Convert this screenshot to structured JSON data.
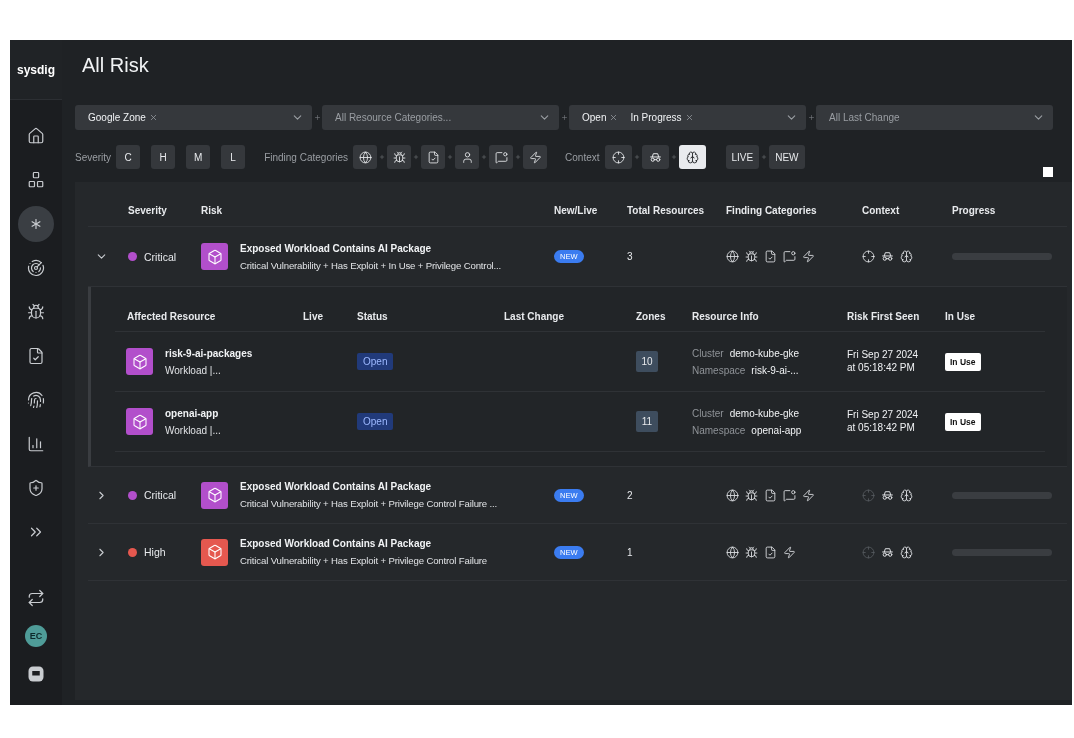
{
  "sidebar": {
    "logo": "sysdig",
    "nav": [
      {
        "kind": "home",
        "selected": false
      },
      {
        "kind": "blocks",
        "selected": false
      },
      {
        "kind": "asterisk",
        "selected": true
      },
      {
        "kind": "radar",
        "selected": false
      },
      {
        "kind": "bug",
        "selected": false
      },
      {
        "kind": "filecheck",
        "selected": false
      },
      {
        "kind": "fingerprint",
        "selected": false
      },
      {
        "kind": "chart",
        "selected": false
      },
      {
        "kind": "shield",
        "selected": false
      },
      {
        "kind": "expand",
        "selected": false
      }
    ],
    "bottom": [
      {
        "kind": "repeat"
      },
      {
        "kind": "avatar",
        "initials": "EC"
      },
      {
        "kind": "chat"
      }
    ]
  },
  "page": {
    "title": "All Risk"
  },
  "filters": [
    {
      "kind": "chips",
      "chips": [
        "Google Zone"
      ]
    },
    {
      "kind": "placeholder",
      "placeholder": "All Resource Categories..."
    },
    {
      "kind": "chips",
      "chips": [
        "Open",
        "In Progress"
      ]
    },
    {
      "kind": "placeholder",
      "placeholder": "All Last Change"
    }
  ],
  "severity_filter": {
    "label": "Severity",
    "options": [
      {
        "label": "C",
        "selected": false
      },
      {
        "label": "H",
        "selected": false
      },
      {
        "label": "M",
        "selected": false
      },
      {
        "label": "L",
        "selected": false
      }
    ]
  },
  "finding_category_filter": {
    "label": "Finding Categories",
    "options": [
      {
        "kind": "globe",
        "selected": false
      },
      {
        "kind": "bug",
        "selected": false
      },
      {
        "kind": "filecheck",
        "selected": false
      },
      {
        "kind": "user",
        "selected": false
      },
      {
        "kind": "message",
        "selected": false
      },
      {
        "kind": "zap",
        "selected": false
      }
    ]
  },
  "context_filter": {
    "label": "Context",
    "options": [
      {
        "kind": "crosshair",
        "selected": false
      },
      {
        "kind": "spy",
        "selected": false
      },
      {
        "kind": "brain",
        "selected": true
      }
    ]
  },
  "status_filter": [
    {
      "label": "LIVE",
      "selected": false
    },
    {
      "label": "NEW",
      "selected": false
    }
  ],
  "table": {
    "columns": [
      "Severity",
      "Risk",
      "New/Live",
      "Total Resources",
      "Finding Categories",
      "Context",
      "Progress"
    ],
    "rows": [
      {
        "expanded": true,
        "severity": "Critical",
        "color": "#b24fcb",
        "title": "Exposed Workload Contains AI Package",
        "description": "Critical Vulnerability + Has Exploit + In Use + Privilege Control...",
        "badge": "NEW",
        "total": "3",
        "findings": [
          {
            "kind": "globe"
          },
          {
            "kind": "bug"
          },
          {
            "kind": "filecheck"
          },
          {
            "kind": "message"
          },
          {
            "kind": "zap"
          }
        ],
        "context": [
          {
            "kind": "crosshair",
            "active": true
          },
          {
            "kind": "spy",
            "active": true
          },
          {
            "kind": "brain",
            "active": true
          }
        ],
        "level": 0,
        "resources": {
          "columns": [
            "Affected Resource",
            "Live",
            "Status",
            "Last Change",
            "Zones",
            "Resource Info",
            "Risk First Seen",
            "In Use"
          ],
          "rows": [
            {
              "name": "risk-9-ai-packages",
              "type": "Workload |...",
              "status": "Open",
              "zones": "10",
              "info": [
                {
                  "label": "Cluster",
                  "value": "demo-kube-gke"
                },
                {
                  "label": "Namespace",
                  "value": "risk-9-ai-..."
                }
              ],
              "first_seen": [
                "Fri Sep 27 2024",
                "at 05:18:42 PM"
              ],
              "in_use": "In Use"
            },
            {
              "name": "openai-app",
              "type": "Workload |...",
              "status": "Open",
              "zones": "11",
              "info": [
                {
                  "label": "Cluster",
                  "value": "demo-kube-gke"
                },
                {
                  "label": "Namespace",
                  "value": "openai-app"
                }
              ],
              "first_seen": [
                "Fri Sep 27 2024",
                "at 05:18:42 PM"
              ],
              "in_use": "In Use"
            }
          ]
        }
      },
      {
        "expanded": false,
        "severity": "Critical",
        "color": "#b24fcb",
        "title": "Exposed Workload Contains AI Package",
        "description": "Critical Vulnerability + Has Exploit + Privilege Control Failure ...",
        "badge": "NEW",
        "total": "2",
        "findings": [
          {
            "kind": "globe"
          },
          {
            "kind": "bug"
          },
          {
            "kind": "filecheck"
          },
          {
            "kind": "message"
          },
          {
            "kind": "zap"
          }
        ],
        "context": [
          {
            "kind": "crosshair",
            "active": false
          },
          {
            "kind": "spy",
            "active": true
          },
          {
            "kind": "brain",
            "active": true
          }
        ],
        "level": 0
      },
      {
        "expanded": false,
        "severity": "High",
        "color": "#e5584f",
        "title": "Exposed Workload Contains AI Package",
        "description": "Critical Vulnerability + Has Exploit + Privilege Control Failure",
        "badge": "NEW",
        "total": "1",
        "findings": [
          {
            "kind": "globe"
          },
          {
            "kind": "bug"
          },
          {
            "kind": "filecheck"
          },
          {
            "kind": "zap"
          }
        ],
        "context": [
          {
            "kind": "crosshair",
            "active": false
          },
          {
            "kind": "spy",
            "active": true
          },
          {
            "kind": "brain",
            "active": true
          }
        ],
        "level": 0
      }
    ]
  }
}
